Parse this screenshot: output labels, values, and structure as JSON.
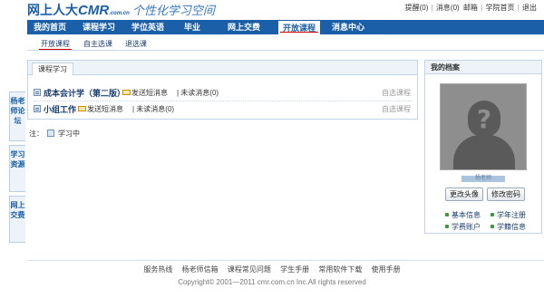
{
  "header": {
    "logo_text": "网上人大",
    "logo_brand": "CMR",
    "logo_domain": ".com.cn",
    "slogan": "个性化学习空间",
    "top_links": [
      {
        "label": "提醒(0)"
      },
      {
        "label": "消息(0)"
      },
      {
        "label": "邮箱"
      },
      {
        "label": "学院首页"
      },
      {
        "label": "退出"
      }
    ]
  },
  "nav": {
    "items": [
      {
        "label": "我的首页"
      },
      {
        "label": "课程学习"
      },
      {
        "label": "学位英语"
      },
      {
        "label": "毕业"
      },
      {
        "label": "网上交费"
      },
      {
        "label": "开放课程"
      },
      {
        "label": "消息中心"
      }
    ],
    "active_index": 5
  },
  "subnav": {
    "items": [
      {
        "label": "开放课程"
      },
      {
        "label": "自主选课"
      },
      {
        "label": "退选课"
      }
    ],
    "active_index": 0
  },
  "sidetabs": [
    {
      "label": "杨老师论坛"
    },
    {
      "label": "学习资源"
    },
    {
      "label": "网上交费"
    }
  ],
  "courses_panel": {
    "tab_label": "课程学习",
    "courses": [
      {
        "name": "成本会计学（第二版）",
        "message_label": "发送短消息",
        "unread_label": "| 未读消息(0)",
        "status": "自选课程"
      },
      {
        "name": "小组工作",
        "message_label": "发送短消息",
        "unread_label": "| 未读消息(0)",
        "status": "自选课程"
      }
    ],
    "legend_prefix": "注：",
    "legend_label": "学习中"
  },
  "profile": {
    "title": "我的档案",
    "username": "杨老师",
    "change_avatar_button": "更改头像",
    "change_password_button": "修改密码",
    "links": [
      {
        "label": "基本信息"
      },
      {
        "label": "学年注册"
      },
      {
        "label": "学费账户"
      },
      {
        "label": "学籍信息"
      }
    ]
  },
  "footer": {
    "links": [
      {
        "label": "服务热线"
      },
      {
        "label": "杨老师信箱"
      },
      {
        "label": "课程常见问题"
      },
      {
        "label": "学生手册"
      },
      {
        "label": "常用软件下载"
      },
      {
        "label": "使用手册"
      }
    ],
    "copyright": "Copyright© 2001—2011 cmr.com.cn Inc.All rights reserved"
  },
  "colors": {
    "nav_blue": "#1a5fa8",
    "active_underline": "#cc0000",
    "link_dot_green": "#3a9a3a"
  }
}
